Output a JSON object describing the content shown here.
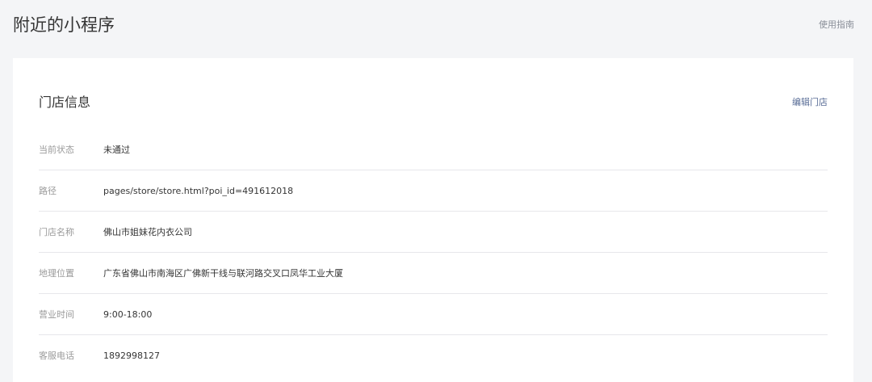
{
  "header": {
    "title": "附近的小程序",
    "guide_link": "使用指南"
  },
  "store_info": {
    "title": "门店信息",
    "edit_link": "编辑门店",
    "rows": [
      {
        "label": "当前状态",
        "value": "未通过"
      },
      {
        "label": "路径",
        "value": "pages/store/store.html?poi_id=491612018"
      },
      {
        "label": "门店名称",
        "value": "佛山市姐妹花内衣公司"
      },
      {
        "label": "地理位置",
        "value": "广东省佛山市南海区广佛新干线与联河路交叉口凤华工业大厦"
      },
      {
        "label": "营业时间",
        "value": "9:00-18:00"
      },
      {
        "label": "客服电话",
        "value": "1892998127"
      }
    ]
  }
}
